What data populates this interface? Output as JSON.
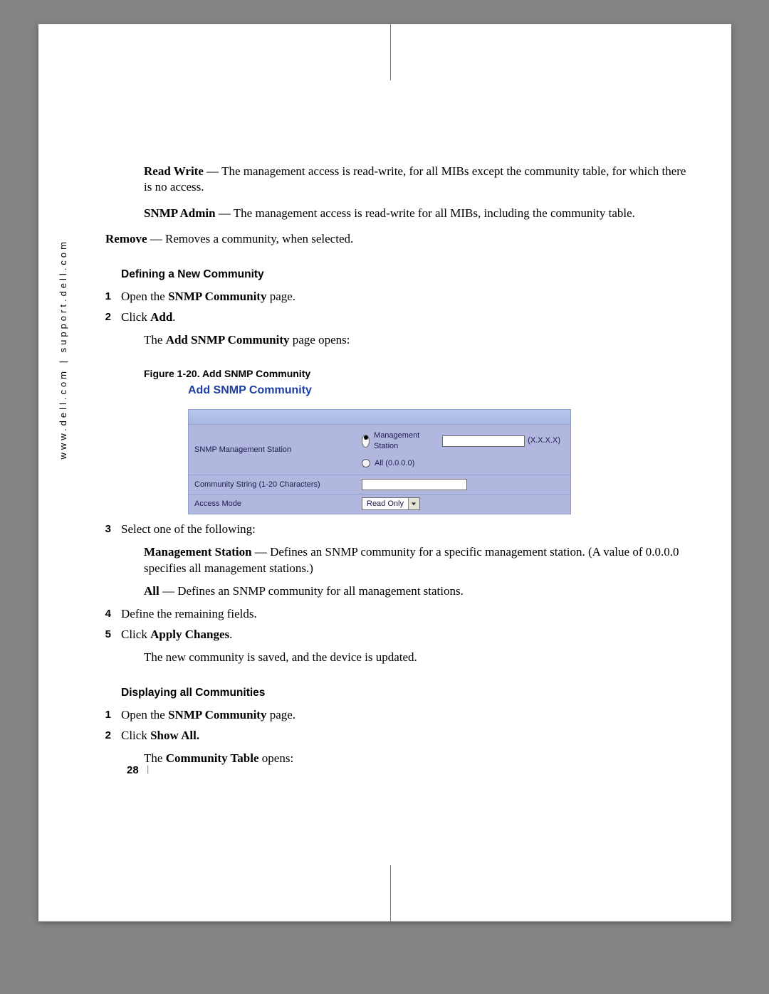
{
  "side_url": "www.dell.com | support.dell.com",
  "intro": {
    "readwrite_label": "Read Write",
    "readwrite_text": " — The management access is read-write, for all MIBs except the community table, for which there is no access.",
    "snmpadmin_label": "SNMP Admin",
    "snmpadmin_text": " — The management access is read-write for all MIBs, including the community table.",
    "remove_label": "Remove",
    "remove_text": " — Removes a community, when selected."
  },
  "section1": {
    "heading": "Defining a New Community",
    "items": [
      {
        "n": "1",
        "pre": "Open the ",
        "bold": "SNMP Community",
        "post": " page."
      },
      {
        "n": "2",
        "pre": "Click ",
        "bold": "Add",
        "post": "."
      }
    ],
    "open_line_pre": "The ",
    "open_line_bold": "Add SNMP Community",
    "open_line_post": " page opens:",
    "fig_caption": "Figure 1-20.    Add SNMP Community",
    "fig_title": "Add SNMP Community"
  },
  "form": {
    "row1_label": "SNMP Management Station",
    "radio_ms": "Management Station",
    "radio_all": "All (0.0.0.0)",
    "ip_hint": "(X.X.X.X)",
    "row2_label": "Community String (1-20 Characters)",
    "row3_label": "Access Mode",
    "access_value": "Read Only"
  },
  "section1b": {
    "items3_n": "3",
    "items3_text": "Select one of the following:",
    "ms_label": "Management Station",
    "ms_text": " — Defines an SNMP community for a specific management station. (A value of 0.0.0.0 specifies all management stations.)",
    "all_label": "All",
    "all_text": " — Defines an SNMP community for all management stations.",
    "items4_n": "4",
    "items4_text": "Define the remaining fields.",
    "items5_n": "5",
    "items5_pre": "Click ",
    "items5_bold": "Apply Changes",
    "items5_post": ".",
    "saved_text": "The new community is saved, and the device is updated."
  },
  "section2": {
    "heading": "Displaying all Communities",
    "items": [
      {
        "n": "1",
        "pre": "Open the ",
        "bold": "SNMP Community",
        "post": " page."
      },
      {
        "n": "2",
        "pre": "Click ",
        "bold": "Show All.",
        "post": ""
      }
    ],
    "table_pre": "The ",
    "table_bold": "Community Table",
    "table_post": " opens:"
  },
  "page_number": "28",
  "footer_bar": "|"
}
